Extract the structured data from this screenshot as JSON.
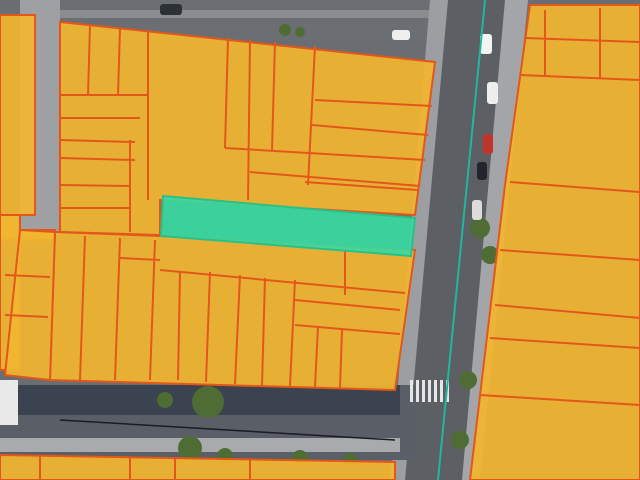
{
  "map": {
    "base": "satellite-imagery",
    "layers": [
      {
        "name": "parcels",
        "fill": "#f2b630",
        "stroke": "#e4571b"
      },
      {
        "name": "selected-parcel",
        "fill": "#38d9a0",
        "stroke": "#2bbf8a"
      },
      {
        "name": "street-centerline",
        "stroke": "#1fb89a"
      }
    ],
    "colors": {
      "street": "#5f6166",
      "sidewalk": "#b9babd",
      "shadow": "#3f4550",
      "tree": "#5b7a3a"
    }
  }
}
